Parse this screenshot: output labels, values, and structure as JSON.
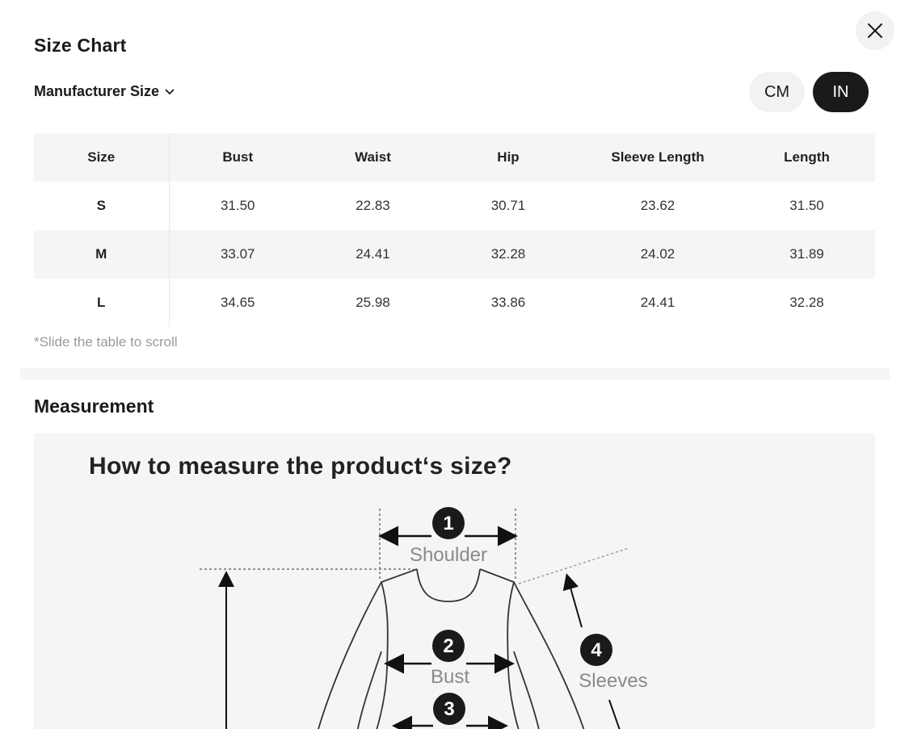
{
  "modal": {
    "title": "Size Chart",
    "size_selector": "Manufacturer Size",
    "units": {
      "cm": "CM",
      "in": "IN",
      "selected": "IN"
    }
  },
  "table": {
    "headers": [
      "Size",
      "Bust",
      "Waist",
      "Hip",
      "Sleeve Length",
      "Length"
    ],
    "rows": [
      [
        "S",
        "31.50",
        "22.83",
        "30.71",
        "23.62",
        "31.50"
      ],
      [
        "M",
        "33.07",
        "24.41",
        "32.28",
        "24.02",
        "31.89"
      ],
      [
        "L",
        "34.65",
        "25.98",
        "33.86",
        "24.41",
        "32.28"
      ]
    ],
    "hint": "*Slide the table to scroll"
  },
  "measurement": {
    "title": "Measurement",
    "guide_title": "How to measure the product‘s size?",
    "points": [
      {
        "num": "1",
        "label": "Shoulder"
      },
      {
        "num": "2",
        "label": "Bust"
      },
      {
        "num": "3",
        "label": ""
      },
      {
        "num": "4",
        "label": "Sleeves"
      }
    ]
  },
  "icons": {
    "close": "close-icon",
    "dropdown": "chevron-down-icon"
  },
  "colors": {
    "accent": "#1a1a1a",
    "muted": "#f5f5f5",
    "hint": "#9a9a9a"
  }
}
